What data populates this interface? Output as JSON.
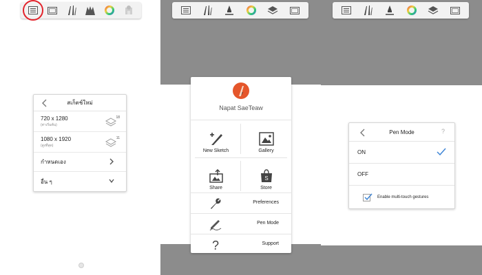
{
  "colors": {
    "accent_red": "#e3232b",
    "check_blue": "#3f86d6",
    "overlay_gray": "#8c8c8c",
    "avatar_orange": "#e5562b"
  },
  "left_toolbar": {
    "icons": [
      "gallery-icon",
      "canvas-icon",
      "brushes-icon",
      "brush-set-icon",
      "color-wheel-icon",
      "disabled-tool-icon"
    ]
  },
  "new_sketch_dialog": {
    "title": "สเก็ตช์ใหม่",
    "options": [
      {
        "size": "720 x 1280",
        "sublabel": "(ค่าเริ่มต้น)",
        "layers": "18"
      },
      {
        "size": "1080 x 1920",
        "sublabel": "(สูงที่สุด)",
        "layers": "11"
      }
    ],
    "custom_label": "กำหนดเอง",
    "other_label": "อื่น ๆ"
  },
  "mid_toolbar": {
    "icons": [
      "list-icon",
      "brushes-icon",
      "pen-tip-icon",
      "color-wheel-icon",
      "layers-icon",
      "canvas-icon"
    ]
  },
  "right_toolbar": {
    "icons": [
      "list-icon",
      "brushes-icon",
      "pen-tip-icon",
      "color-wheel-icon",
      "layers-icon",
      "canvas-icon"
    ]
  },
  "gallery_menu": {
    "username": "Napat SaeTeaw",
    "grid": [
      {
        "label": "New Sketch",
        "icon": "new-sketch-icon"
      },
      {
        "label": "Gallery",
        "icon": "gallery-icon"
      },
      {
        "label": "Share",
        "icon": "share-icon"
      },
      {
        "label": "Store",
        "icon": "store-icon"
      }
    ],
    "list": [
      {
        "label": "Preferences",
        "icon": "wrench-icon"
      },
      {
        "label": "Pen Mode",
        "icon": "pen-mode-icon"
      },
      {
        "label": "Support",
        "icon": "question-icon"
      }
    ]
  },
  "pen_mode_dialog": {
    "title": "Pen Mode",
    "help": "?",
    "on_label": "ON",
    "off_label": "OFF",
    "gesture_label": "Enable multi-touch gestures"
  }
}
